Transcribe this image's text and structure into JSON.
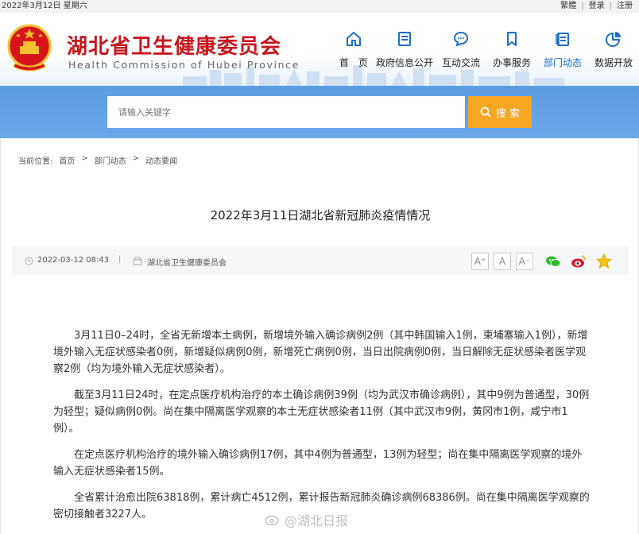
{
  "topbar": {
    "date": "2022年3月12日 星期六",
    "links": [
      "繁體",
      "登录",
      "注册"
    ]
  },
  "header": {
    "title_cn": "湖北省卫生健康委员会",
    "title_en": "Health Commission of Hubei Province"
  },
  "nav": [
    {
      "label": "首　页",
      "icon": "home-icon"
    },
    {
      "label": "政府信息公开",
      "icon": "document-icon"
    },
    {
      "label": "互动交流",
      "icon": "chat-icon"
    },
    {
      "label": "办事服务",
      "icon": "bookmark-icon"
    },
    {
      "label": "部门动态",
      "icon": "news-icon",
      "active": true
    },
    {
      "label": "数据开放",
      "icon": "piechart-icon"
    }
  ],
  "search": {
    "placeholder": "请输入关键字",
    "button_label": "搜 索"
  },
  "breadcrumb": {
    "prefix": "当前位置:",
    "items": [
      "首页",
      "部门动态",
      "动态要闻"
    ],
    "separator": ">"
  },
  "article": {
    "title": "2022年3月11日湖北省新冠肺炎疫情情况",
    "date": "2022-03-12 08:43",
    "separator": "|",
    "source": "湖北省卫生健康委员会",
    "paragraphs": [
      "3月11日0–24时，全省无新增本土病例，新增境外输入确诊病例2例（其中韩国输入1例，柬埔寨输入1例），新增境外输入无症状感染者0例，新增疑似病例0例，新增死亡病例0例，当日出院病例0例，当日解除无症状感染者医学观察2例（均为境外输入无症状感染者）。",
      "截至3月11日24时，在定点医疗机构治疗的本土确诊病例39例（均为武汉市确诊病例），其中9例为普通型，30例为轻型；疑似病例0例。尚在集中隔离医学观察的本土无症状感染者11例（其中武汉市9例，黄冈市1例，咸宁市1例）。",
      "在定点医疗机构治疗的境外输入确诊病例17例，其中4例为普通型，13例为轻型；尚在集中隔离医学观察的境外输入无症状感染者15例。",
      "全省累计治愈出院63818例，累计病亡4512例，累计报告新冠肺炎确诊病例68386例。尚在集中隔离医学观察的密切接触者3227人。"
    ]
  },
  "font_size_buttons": [
    "A⁺",
    "A",
    "A⁻"
  ],
  "watermark": "@湖北日报",
  "colors": {
    "brand_red": "#c8161d",
    "nav_blue": "#1a6fc6",
    "band_blue": "#5b9be0",
    "search_orange": "#f5a623"
  }
}
